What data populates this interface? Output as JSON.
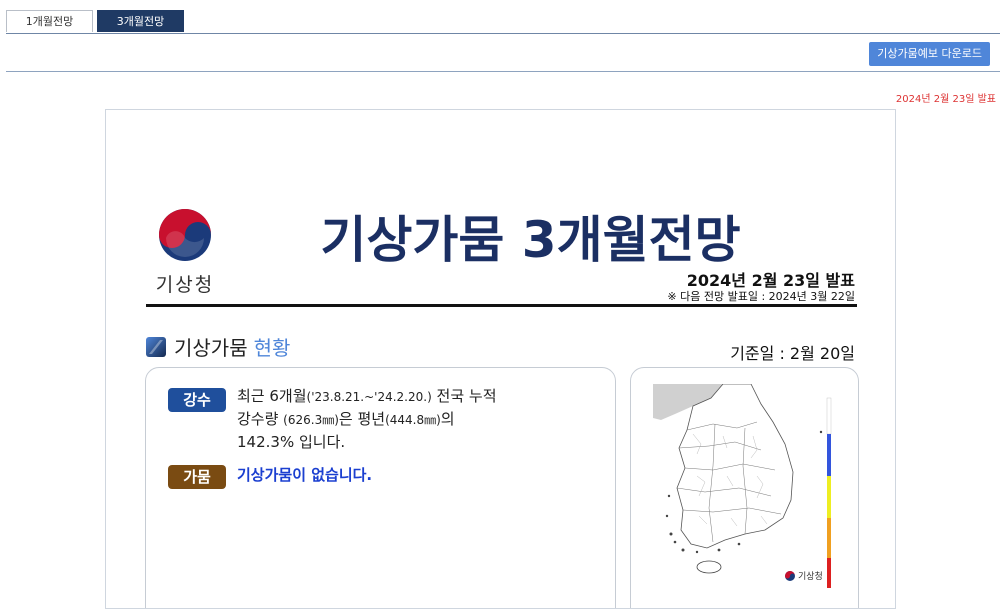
{
  "tabs": [
    {
      "label": "1개월전망",
      "active": false
    },
    {
      "label": "3개월전망",
      "active": true
    }
  ],
  "download_button": "기상가뭄예보 다운로드",
  "issued_date": "2024년 2월 23일 발표",
  "doc": {
    "org_name": "기상청",
    "title": "기상가뭄 3개월전망",
    "pub_date": "2024년 2월 23일 발표",
    "next_date": "※ 다음 전망 발표일 : 2024년 3월 22일",
    "section_label": "기상가뭄",
    "section_label_highlight": "현황",
    "base_date": "기준일 : 2월 20일",
    "rain": {
      "badge": "강수",
      "line1_a": "최근 6개월",
      "line1_b": "('23.8.21.~'24.2.20.)",
      "line1_c": " 전국 누적",
      "line2_a": "강수량 ",
      "line2_b": "(626.3㎜)",
      "line2_c": "은 평년",
      "line2_d": "(444.8㎜)",
      "line2_e": "의",
      "line3": "142.3% 입니다."
    },
    "drought": {
      "badge": "가뭄",
      "text": "기상가뭄이 없습니다."
    },
    "map_logo_text": "기상청"
  },
  "colors": {
    "tab_active": "#1f3a64",
    "download": "#4f86d9",
    "issued": "#dd3333",
    "title": "#1b2f63",
    "badge_rain": "#1f4f9c",
    "badge_drought": "#7a4b12",
    "drought_text": "#1b3fd0",
    "legend": [
      "#ffffff",
      "#3355dd",
      "#eeee22",
      "#f0a020",
      "#dd2020"
    ]
  }
}
